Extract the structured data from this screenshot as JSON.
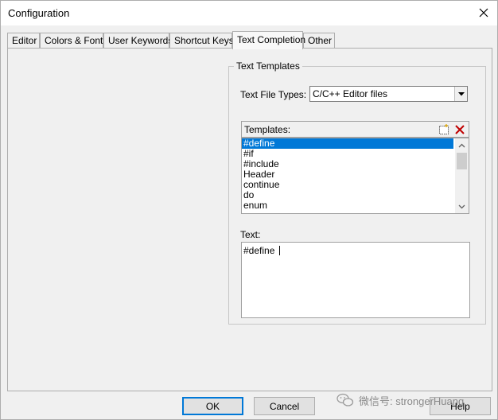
{
  "window": {
    "title": "Configuration"
  },
  "tabs": [
    {
      "label": "Editor",
      "active": false
    },
    {
      "label": "Colors & Fonts",
      "active": false
    },
    {
      "label": "User Keywords",
      "active": false
    },
    {
      "label": "Shortcut Keys",
      "active": false
    },
    {
      "label": "Text Completion",
      "active": true
    },
    {
      "label": "Other",
      "active": false
    }
  ],
  "text_templates": {
    "group_title": "Text Templates",
    "file_types_label": "Text File Types:",
    "file_types_value": "C/C++ Editor files",
    "templates_label": "Templates:",
    "templates": [
      "#define",
      "#if",
      "#include",
      "Header",
      "continue",
      "do",
      "enum"
    ],
    "selected_index": 0,
    "text_label": "Text:",
    "text_value": "#define "
  },
  "buttons": {
    "ok": "OK",
    "cancel": "Cancel",
    "help": "Help"
  },
  "watermark": {
    "text": "微信号: strongerHuang"
  },
  "colors": {
    "selection": "#0078d7",
    "delete_icon": "#c00000"
  }
}
